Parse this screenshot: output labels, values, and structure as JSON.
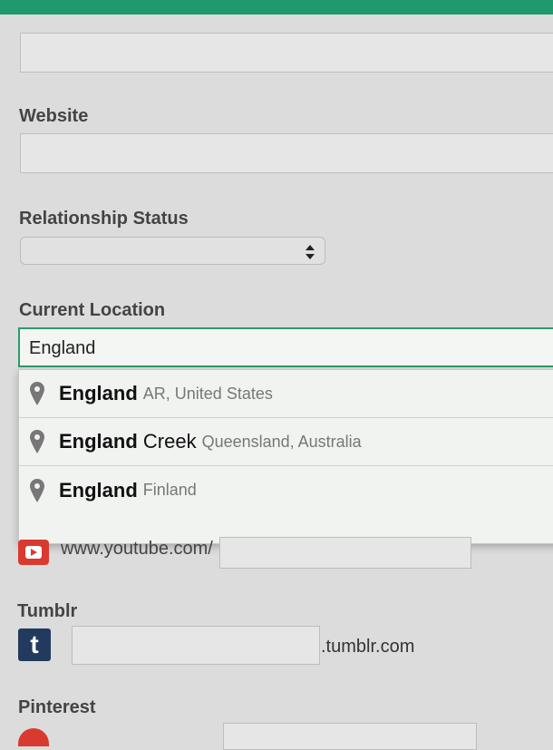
{
  "form": {
    "website_label": "Website",
    "relationship_label": "Relationship Status",
    "location_label": "Current Location",
    "location_value": "England",
    "tumblr_label": "Tumblr",
    "pinterest_label": "Pinterest",
    "youtube_prefix": "www.youtube.com/",
    "tumblr_suffix": ".tumblr.com",
    "tumblr_icon_letter": "t"
  },
  "suggestions": [
    {
      "main": "England",
      "extra": "",
      "sub": "AR, United States"
    },
    {
      "main": "England",
      "extra": " Creek",
      "sub": "Queensland, Australia"
    },
    {
      "main": "England",
      "extra": "",
      "sub": "Finland"
    }
  ],
  "colors": {
    "accent": "#1f9a6f",
    "youtube": "#d93a30",
    "tumblr": "#223a5e"
  }
}
